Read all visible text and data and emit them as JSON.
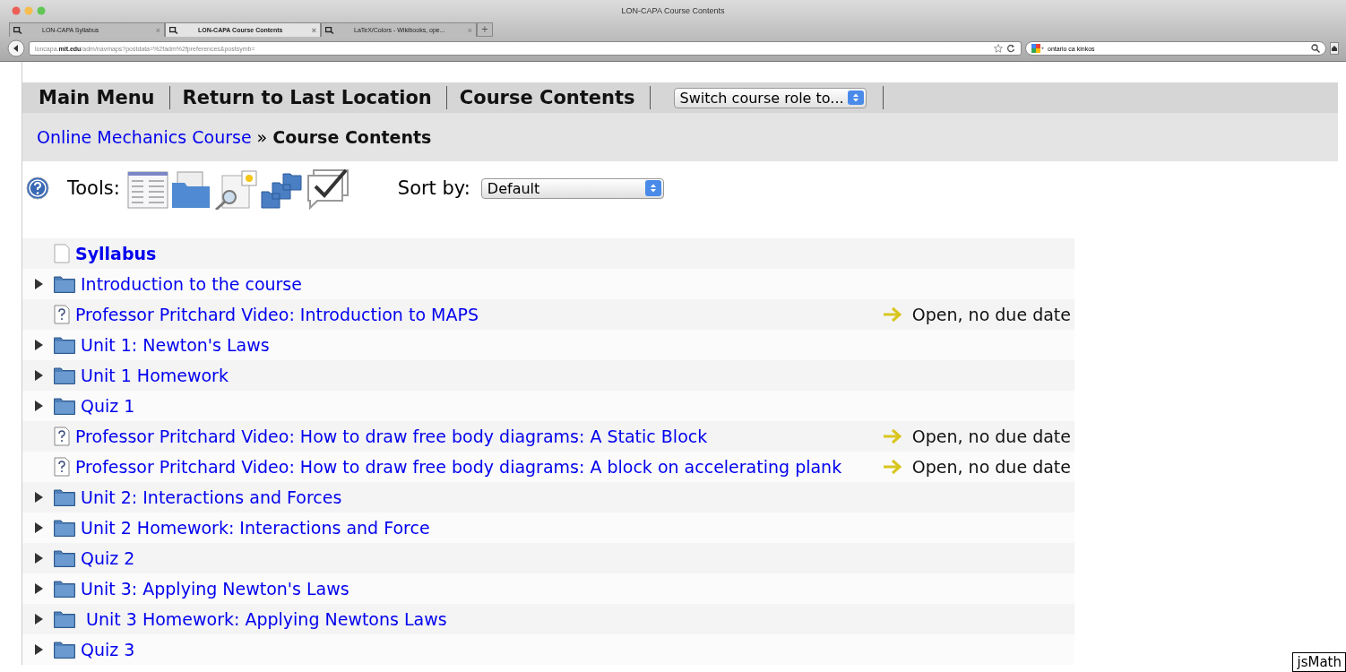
{
  "window": {
    "title": "LON-CAPA Course Contents"
  },
  "tabs": [
    {
      "label": "LON-CAPA Syllabus",
      "close": "×",
      "selected": false
    },
    {
      "label": "LON-CAPA Course Contents",
      "close": "×",
      "selected": true
    },
    {
      "label": "LaTeX/Colors - Wikibooks, ope...",
      "close": "×",
      "selected": false
    }
  ],
  "new_tab": "+",
  "address_bar": {
    "url_start": "loncapa.",
    "url_host": "mit.edu",
    "url_rest": "/adm/navmaps?postdata=%2fadm%2fpreferences&postsymb="
  },
  "search_field": {
    "value": "ontario ca kinkos"
  },
  "nav_menu": {
    "items": [
      "Main Menu",
      "Return to Last Location",
      "Course Contents"
    ],
    "role_select": "Switch course role to..."
  },
  "breadcrumb": {
    "link": "Online Mechanics Course",
    "separator": "»",
    "current": "Course Contents"
  },
  "tools": {
    "label": "Tools:",
    "sort_label": "Sort by:",
    "sort_value": "Default"
  },
  "contents": [
    {
      "kind": "page",
      "title": "Syllabus",
      "bold": true
    },
    {
      "kind": "folder",
      "title": "Introduction to the course"
    },
    {
      "kind": "problem",
      "title": "Professor Pritchard Video: Introduction to MAPS",
      "status": "Open, no due date"
    },
    {
      "kind": "folder",
      "title": "Unit 1: Newton's Laws"
    },
    {
      "kind": "folder",
      "title": "Unit 1 Homework"
    },
    {
      "kind": "folder",
      "title": "Quiz 1"
    },
    {
      "kind": "problem",
      "title": "Professor Pritchard Video: How to draw free body diagrams: A Static Block",
      "status": "Open, no due date"
    },
    {
      "kind": "problem",
      "title": "Professor Pritchard Video: How to draw free body diagrams: A block on accelerating plank",
      "status": "Open, no due date"
    },
    {
      "kind": "folder",
      "title": "Unit 2: Interactions and Forces"
    },
    {
      "kind": "folder",
      "title": "Unit 2 Homework: Interactions and Force"
    },
    {
      "kind": "folder",
      "title": "Quiz 2"
    },
    {
      "kind": "folder",
      "title": "Unit 3: Applying Newton's Laws"
    },
    {
      "kind": "folder",
      "title": " Unit 3 Homework: Applying Newtons Laws"
    },
    {
      "kind": "folder",
      "title": "Quiz 3"
    }
  ],
  "jsmath_button": "jsMath"
}
